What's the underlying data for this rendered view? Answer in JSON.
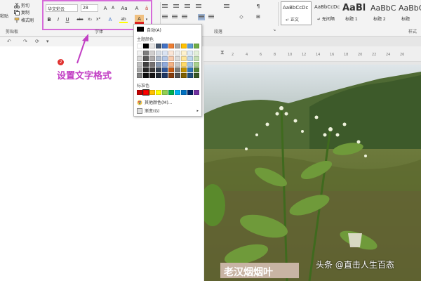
{
  "clipboard": {
    "paste": "粘贴",
    "cut": "剪切",
    "copy": "复制",
    "format_painter": "格式刷",
    "group_label": "剪贴板"
  },
  "font": {
    "name": "华文彩云",
    "size": "28",
    "grow": "A",
    "shrink": "A",
    "case": "Aa",
    "clear": "A",
    "bold": "B",
    "italic": "I",
    "underline": "U",
    "strike": "abc",
    "subscript": "x₂",
    "superscript": "x²",
    "effects": "A",
    "highlight": "ab",
    "font_color": "A",
    "group_label": "字体"
  },
  "paragraph": {
    "group_label": "段落"
  },
  "styles": {
    "group_label": "样式",
    "items": [
      {
        "preview": "AaBbCcDc",
        "name": "↵ 正文"
      },
      {
        "preview": "AaBbCcDc",
        "name": "↵ 无间隔"
      },
      {
        "preview": "AaBl",
        "name": "标题 1"
      },
      {
        "preview": "AaBbC",
        "name": "标题 2"
      },
      {
        "preview": "AaBbC",
        "name": "标题"
      }
    ]
  },
  "color_menu": {
    "auto_label": "自动(A)",
    "theme_heading": "主题颜色",
    "standard_heading": "标准色",
    "more_colors": "其他颜色(M)...",
    "gradient": "渐变(G)",
    "theme_columns": [
      [
        "#ffffff",
        "#f2f2f2",
        "#d9d9d9",
        "#bfbfbf",
        "#a6a6a6",
        "#808080"
      ],
      [
        "#000000",
        "#7f7f7f",
        "#595959",
        "#404040",
        "#262626",
        "#0d0d0d"
      ],
      [
        "#e7e6e6",
        "#d0cece",
        "#aeabab",
        "#757171",
        "#3a3838",
        "#171616"
      ],
      [
        "#44546a",
        "#d6dce4",
        "#adb9ca",
        "#8496b0",
        "#333f4f",
        "#222a35"
      ],
      [
        "#4472c4",
        "#dae3f3",
        "#b4c7e7",
        "#8faadc",
        "#2f5597",
        "#1f3864"
      ],
      [
        "#ed7d31",
        "#fbe5d6",
        "#f8cbad",
        "#f4b183",
        "#c55a11",
        "#843c0c"
      ],
      [
        "#a5a5a5",
        "#ededed",
        "#dbdbdb",
        "#c9c9c9",
        "#7b7b7b",
        "#525252"
      ],
      [
        "#ffc000",
        "#fff2cc",
        "#ffe699",
        "#ffd966",
        "#bf9000",
        "#7f6000"
      ],
      [
        "#5b9bd5",
        "#deebf7",
        "#bdd7ee",
        "#9dc3e6",
        "#2e75b6",
        "#1f4e79"
      ],
      [
        "#70ad47",
        "#e2f0d9",
        "#c5e0b4",
        "#a9d18e",
        "#548235",
        "#385723"
      ]
    ],
    "standard": [
      "#c00000",
      "#ff0000",
      "#ffc000",
      "#ffff00",
      "#92d050",
      "#00b050",
      "#00b0f0",
      "#0070c0",
      "#002060",
      "#7030a0"
    ]
  },
  "annotation": {
    "badge": "2",
    "text": "设置文字格式",
    "color": "#c23fc4"
  },
  "ruler": {
    "ticks": [
      "2",
      "4",
      "6",
      "8",
      "10",
      "12",
      "14",
      "16",
      "18",
      "20",
      "22",
      "24",
      "26"
    ]
  },
  "watermark": {
    "left": "老汉烟烟叶",
    "right": "头条 @直击人生百态"
  }
}
